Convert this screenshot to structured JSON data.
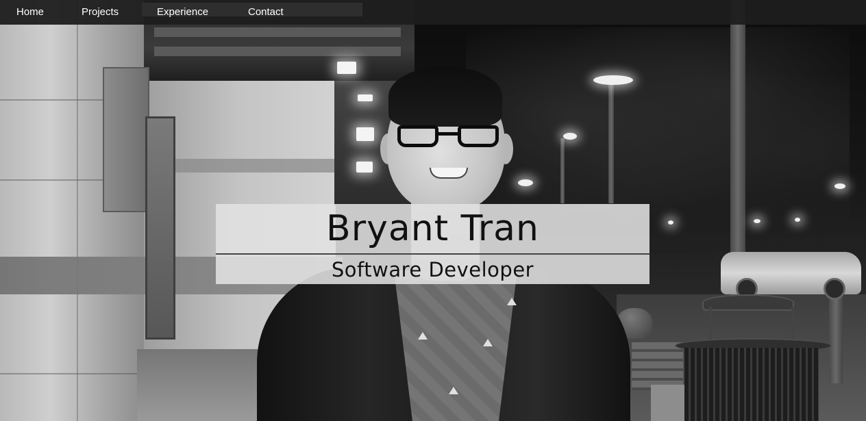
{
  "nav": {
    "items": [
      {
        "label": "Home"
      },
      {
        "label": "Projects"
      },
      {
        "label": "Experience"
      },
      {
        "label": "Contact"
      }
    ]
  },
  "hero": {
    "name": "Bryant Tran",
    "role": "Software Developer"
  },
  "colors": {
    "nav_background": "#1e1e1e",
    "nav_text": "#ffffff",
    "card_background": "#e1e1e1",
    "card_text": "#111111"
  }
}
